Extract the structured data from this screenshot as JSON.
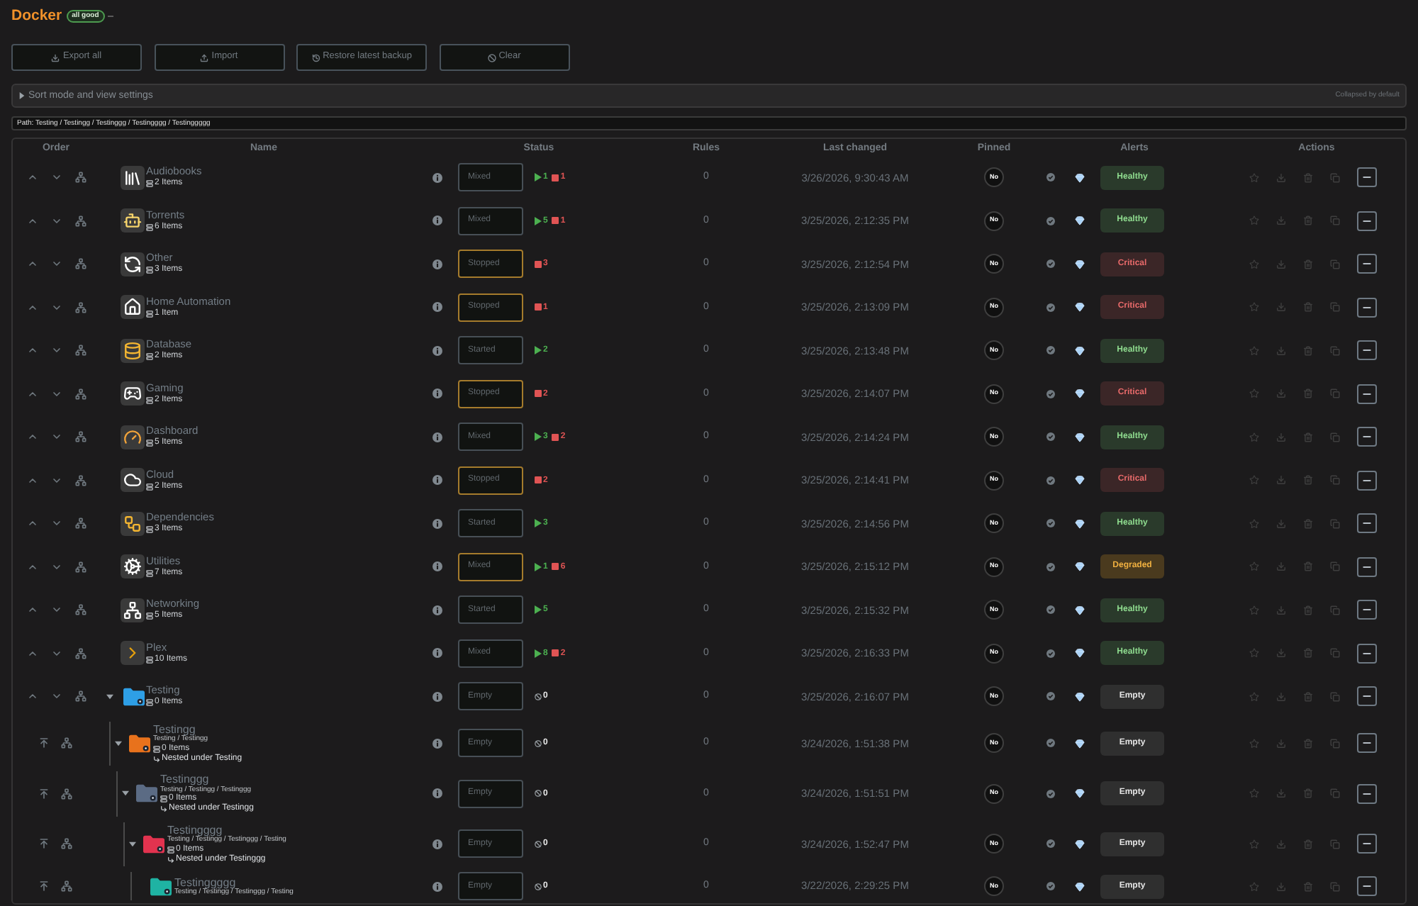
{
  "header": {
    "title": "Docker",
    "status_badge": "all good"
  },
  "toolbar": [
    {
      "label": "Export all",
      "kind": "export"
    },
    {
      "label": "Import",
      "kind": "import"
    },
    {
      "label": "Restore latest backup",
      "kind": "restore"
    },
    {
      "label": "Clear",
      "kind": "clear"
    }
  ],
  "sort_settings": {
    "label": "Sort mode and view settings",
    "expanded": false,
    "note": "Collapsed by default"
  },
  "path": "Path: Testing / Testingg / Testinggg / Testingggg / Testinggggg",
  "table": {
    "columns": [
      "Order",
      "Name",
      "Status",
      "Rules",
      "Last changed",
      "Pinned",
      "Alerts",
      "Actions"
    ],
    "rows": [
      {
        "kind": "app",
        "name": "Audiobooks",
        "items": "2 Items",
        "status": {
          "value": "Mixed",
          "flagged": false
        },
        "counts": [
          {
            "kind": "running",
            "count": "1"
          },
          {
            "kind": "stopped",
            "count": "1"
          }
        ],
        "rules": "0",
        "last_changed": "3/26/2026, 9:30:43 AM",
        "pinned": {
          "label": "No",
          "on": false
        },
        "alert": {
          "label": "Healthy",
          "kind": "healthy"
        }
      },
      {
        "kind": "app",
        "name": "Torrents",
        "items": "6 Items",
        "status": {
          "value": "Mixed",
          "flagged": false
        },
        "counts": [
          {
            "kind": "running",
            "count": "5"
          },
          {
            "kind": "stopped",
            "count": "1"
          }
        ],
        "rules": "0",
        "last_changed": "3/25/2026, 2:12:35 PM",
        "pinned": {
          "label": "No",
          "on": false
        },
        "alert": {
          "label": "Healthy",
          "kind": "healthy"
        }
      },
      {
        "kind": "app",
        "name": "Other",
        "items": "3 Items",
        "status": {
          "value": "Stopped",
          "flagged": true
        },
        "counts": [
          {
            "kind": "stopped",
            "count": "3"
          }
        ],
        "rules": "0",
        "last_changed": "3/25/2026, 2:12:54 PM",
        "pinned": {
          "label": "No",
          "on": false
        },
        "alert": {
          "label": "Critical",
          "kind": "critical"
        }
      },
      {
        "kind": "app",
        "name": "Home Automation",
        "items": "1 Item",
        "status": {
          "value": "Stopped",
          "flagged": true
        },
        "counts": [
          {
            "kind": "stopped",
            "count": "1"
          }
        ],
        "rules": "0",
        "last_changed": "3/25/2026, 2:13:09 PM",
        "pinned": {
          "label": "No",
          "on": false
        },
        "alert": {
          "label": "Critical",
          "kind": "critical"
        }
      },
      {
        "kind": "app",
        "name": "Database",
        "items": "2 Items",
        "status": {
          "value": "Started",
          "flagged": false
        },
        "counts": [
          {
            "kind": "running",
            "count": "2"
          }
        ],
        "rules": "0",
        "last_changed": "3/25/2026, 2:13:48 PM",
        "pinned": {
          "label": "No",
          "on": false
        },
        "alert": {
          "label": "Healthy",
          "kind": "healthy"
        }
      },
      {
        "kind": "app",
        "name": "Gaming",
        "items": "2 Items",
        "status": {
          "value": "Stopped",
          "flagged": true
        },
        "counts": [
          {
            "kind": "stopped",
            "count": "2"
          }
        ],
        "rules": "0",
        "last_changed": "3/25/2026, 2:14:07 PM",
        "pinned": {
          "label": "No",
          "on": false
        },
        "alert": {
          "label": "Critical",
          "kind": "critical"
        }
      },
      {
        "kind": "app",
        "name": "Dashboard",
        "items": "5 Items",
        "status": {
          "value": "Mixed",
          "flagged": false
        },
        "counts": [
          {
            "kind": "running",
            "count": "3"
          },
          {
            "kind": "stopped",
            "count": "2"
          }
        ],
        "rules": "0",
        "last_changed": "3/25/2026, 2:14:24 PM",
        "pinned": {
          "label": "No",
          "on": false
        },
        "alert": {
          "label": "Healthy",
          "kind": "healthy"
        }
      },
      {
        "kind": "app",
        "name": "Cloud",
        "items": "2 Items",
        "status": {
          "value": "Stopped",
          "flagged": true
        },
        "counts": [
          {
            "kind": "stopped",
            "count": "2"
          }
        ],
        "rules": "0",
        "last_changed": "3/25/2026, 2:14:41 PM",
        "pinned": {
          "label": "No",
          "on": false
        },
        "alert": {
          "label": "Critical",
          "kind": "critical"
        }
      },
      {
        "kind": "app",
        "name": "Dependencies",
        "items": "3 Items",
        "status": {
          "value": "Started",
          "flagged": false
        },
        "counts": [
          {
            "kind": "running",
            "count": "3"
          }
        ],
        "rules": "0",
        "last_changed": "3/25/2026, 2:14:56 PM",
        "pinned": {
          "label": "No",
          "on": false
        },
        "alert": {
          "label": "Healthy",
          "kind": "healthy"
        }
      },
      {
        "kind": "app",
        "name": "Utilities",
        "items": "7 Items",
        "status": {
          "value": "Mixed",
          "flagged": true
        },
        "counts": [
          {
            "kind": "running",
            "count": "1"
          },
          {
            "kind": "stopped",
            "count": "6"
          }
        ],
        "rules": "0",
        "last_changed": "3/25/2026, 2:15:12 PM",
        "pinned": {
          "label": "No",
          "on": false
        },
        "alert": {
          "label": "Degraded",
          "kind": "degraded"
        }
      },
      {
        "kind": "app",
        "name": "Networking",
        "items": "5 Items",
        "status": {
          "value": "Started",
          "flagged": false
        },
        "counts": [
          {
            "kind": "running",
            "count": "5"
          }
        ],
        "rules": "0",
        "last_changed": "3/25/2026, 2:15:32 PM",
        "pinned": {
          "label": "No",
          "on": false
        },
        "alert": {
          "label": "Healthy",
          "kind": "healthy"
        }
      },
      {
        "kind": "app",
        "name": "Plex",
        "items": "10 Items",
        "status": {
          "value": "Mixed",
          "flagged": false
        },
        "counts": [
          {
            "kind": "running",
            "count": "8"
          },
          {
            "kind": "stopped",
            "count": "2"
          }
        ],
        "rules": "0",
        "last_changed": "3/25/2026, 2:16:33 PM",
        "pinned": {
          "label": "No",
          "on": false
        },
        "alert": {
          "label": "Healthy",
          "kind": "healthy"
        }
      },
      {
        "kind": "folder",
        "name": "Testing",
        "color": "#2e9fe6",
        "expanded": true,
        "items": "0 Items",
        "status": {
          "value": "Empty",
          "flagged": false
        },
        "counts": [
          {
            "kind": "none",
            "count": "0"
          }
        ],
        "rules": "0",
        "last_changed": "3/25/2026, 2:16:07 PM",
        "pinned": {
          "label": "No",
          "on": false
        },
        "alert": {
          "label": "Empty",
          "kind": "empty"
        },
        "children": [
          {
            "kind": "folder",
            "name": "Testingg",
            "color": "#e8721c",
            "expanded": true,
            "path": "Testing / Testingg",
            "items": "0 Items",
            "nested_under": "Nested under Testing",
            "status": {
              "value": "Empty",
              "flagged": false
            },
            "counts": [
              {
                "kind": "none",
                "count": "0"
              }
            ],
            "rules": "0",
            "last_changed": "3/24/2026, 1:51:38 PM",
            "pinned": {
              "label": "No",
              "on": false
            },
            "alert": {
              "label": "Empty",
              "kind": "empty"
            },
            "children": [
              {
                "kind": "folder",
                "name": "Testinggg",
                "color": "#5b6b84",
                "expanded": true,
                "path": "Testing / Testingg / Testinggg",
                "items": "0 Items",
                "nested_under": "Nested under Testingg",
                "status": {
                  "value": "Empty",
                  "flagged": false
                },
                "counts": [
                  {
                    "kind": "none",
                    "count": "0"
                  }
                ],
                "rules": "0",
                "last_changed": "3/24/2026, 1:51:51 PM",
                "pinned": {
                  "label": "No",
                  "on": false
                },
                "alert": {
                  "label": "Empty",
                  "kind": "empty"
                },
                "children": [
                  {
                    "kind": "folder",
                    "name": "Testingggg",
                    "color": "#e2334f",
                    "expanded": true,
                    "path": "Testing / Testingg / Testinggg / Testing",
                    "items": "0 Items",
                    "nested_under": "Nested under Testinggg",
                    "status": {
                      "value": "Empty",
                      "flagged": false
                    },
                    "counts": [
                      {
                        "kind": "none",
                        "count": "0"
                      }
                    ],
                    "rules": "0",
                    "last_changed": "3/24/2026, 1:52:47 PM",
                    "pinned": {
                      "label": "No",
                      "on": false
                    },
                    "alert": {
                      "label": "Empty",
                      "kind": "empty"
                    },
                    "children": [
                      {
                        "kind": "folder",
                        "name": "Testinggggg",
                        "color": "#1fb3a3",
                        "path": "Testing / Testingg / Testinggg / Testing",
                        "status": {
                          "value": "Empty",
                          "flagged": false
                        },
                        "counts": [
                          {
                            "kind": "none",
                            "count": "0"
                          }
                        ],
                        "rules": "0",
                        "last_changed": "3/22/2026, 2:29:25 PM",
                        "pinned": {
                          "label": "No",
                          "on": false
                        },
                        "alert": {
                          "label": "Empty",
                          "kind": "empty"
                        }
                      }
                    ]
                  }
                ]
              }
            ]
          }
        ]
      }
    ]
  }
}
